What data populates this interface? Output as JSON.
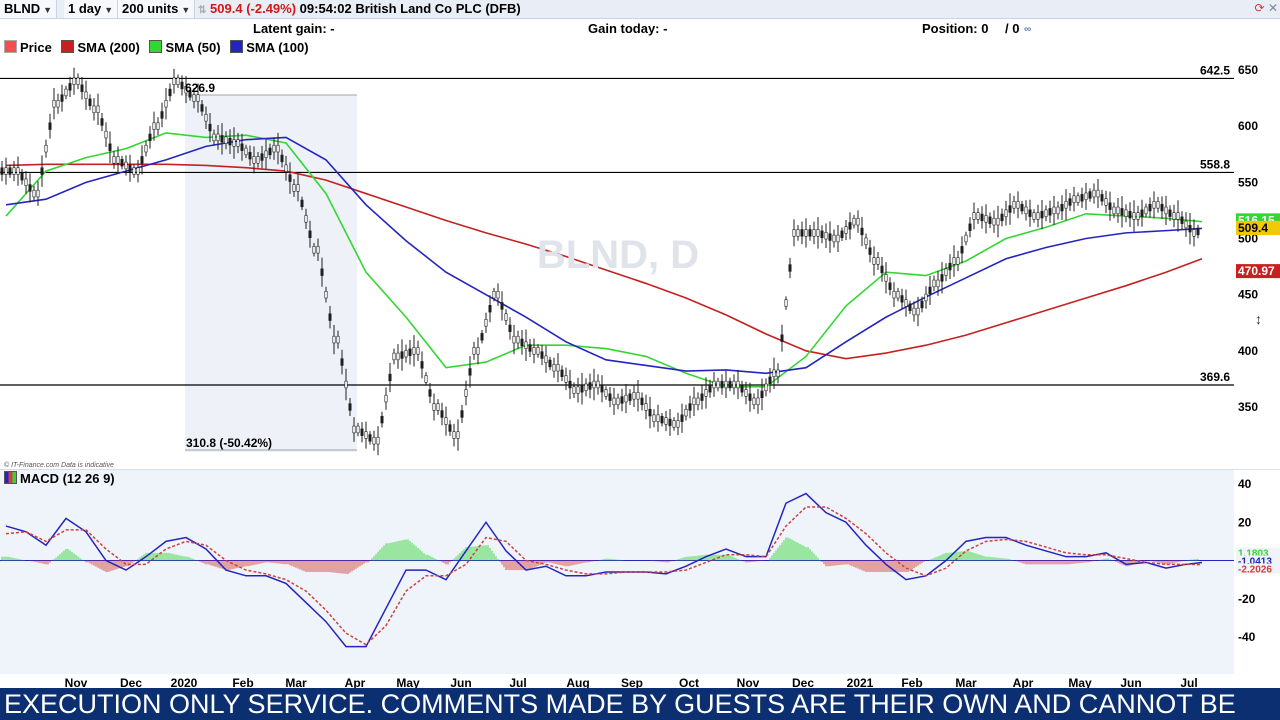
{
  "toolbar": {
    "symbol": "BLND",
    "interval": "1 day",
    "units": "200 units",
    "price": "509.4",
    "change": "(-2.49%)",
    "time": "09:54:02",
    "instrument": "British Land Co PLC (DFB)"
  },
  "info": {
    "latent_gain": "Latent gain: -",
    "gain_today": "Gain today: -",
    "position": "Position: 0",
    "position_sep": "/ 0"
  },
  "legend": [
    {
      "label": "Price",
      "color": "#e8f0e8"
    },
    {
      "label": "SMA (200)",
      "color": "#c62020"
    },
    {
      "label": "SMA (50)",
      "color": "#33d633"
    },
    {
      "label": "SMA (100)",
      "color": "#2424c0"
    }
  ],
  "watermark": "BLND, D",
  "disclaimer": "© IT-Finance.com  Data is indicative",
  "macd_label": "MACD (12 26 9)",
  "ticker_text": "EXECUTION ONLY SERVICE. COMMENTS MADE BY GUESTS ARE THEIR OWN AND CANNOT BE",
  "chart_data": [
    {
      "type": "candlestick",
      "symbol": "BLND",
      "ylim": [
        300,
        675
      ],
      "y_ticks": [
        350,
        400,
        450,
        500,
        550,
        600,
        650
      ],
      "x_ticks": [
        "Nov",
        "Dec",
        "2020",
        "Feb",
        "Mar",
        "Apr",
        "May",
        "Jun",
        "Jul",
        "Aug",
        "Sep",
        "Oct",
        "Nov",
        "Dec",
        "2021",
        "Feb",
        "Mar",
        "Apr",
        "May",
        "Jun",
        "Jul"
      ],
      "horizontal_lines": [
        {
          "value": 642.5,
          "label": "642.5"
        },
        {
          "value": 558.8,
          "label": "558.8"
        },
        {
          "value": 369.6,
          "label": "369.6"
        }
      ],
      "annotations": [
        {
          "label": "626.9",
          "value": 626.9
        },
        {
          "label": "310.8 (-50.42%)",
          "value": 310.8
        }
      ],
      "last_values": [
        {
          "label": "516.15",
          "series": "SMA (50)",
          "color": "#33d633",
          "value": 516.15
        },
        {
          "label": "509.4",
          "series": "Price",
          "color": "#f2c800",
          "value": 509.4
        },
        {
          "label": "470.97",
          "series": "SMA (200)",
          "color": "#c62020",
          "value": 470.97
        }
      ],
      "series": [
        {
          "name": "SMA (200)",
          "color": "#c62020",
          "x": [
            0,
            40,
            80,
            120,
            160,
            200,
            240,
            280,
            320,
            360,
            400,
            440,
            480,
            520,
            560,
            600,
            640,
            680,
            720,
            760,
            800,
            840,
            880,
            920,
            960,
            1000,
            1040,
            1080,
            1120,
            1160,
            1196
          ],
          "values": [
            565,
            566,
            566,
            566,
            566,
            565,
            563,
            560,
            552,
            540,
            528,
            516,
            505,
            495,
            484,
            472,
            460,
            447,
            432,
            415,
            400,
            393,
            398,
            405,
            414,
            425,
            436,
            447,
            458,
            470,
            482
          ]
        },
        {
          "name": "SMA (50)",
          "color": "#33d633",
          "x": [
            0,
            40,
            80,
            120,
            160,
            200,
            240,
            280,
            320,
            360,
            400,
            440,
            480,
            520,
            560,
            600,
            640,
            680,
            720,
            760,
            800,
            840,
            880,
            920,
            960,
            1000,
            1040,
            1080,
            1120,
            1160,
            1196
          ],
          "values": [
            520,
            560,
            572,
            580,
            594,
            590,
            592,
            585,
            540,
            470,
            430,
            385,
            390,
            405,
            405,
            402,
            395,
            380,
            368,
            368,
            395,
            440,
            470,
            467,
            480,
            500,
            510,
            522,
            520,
            518,
            515
          ]
        },
        {
          "name": "SMA (100)",
          "color": "#2424c0",
          "x": [
            0,
            40,
            80,
            120,
            160,
            200,
            240,
            280,
            320,
            360,
            400,
            440,
            480,
            520,
            560,
            600,
            640,
            680,
            720,
            760,
            800,
            840,
            880,
            920,
            960,
            1000,
            1040,
            1080,
            1120,
            1160,
            1196
          ],
          "values": [
            530,
            535,
            550,
            560,
            570,
            582,
            588,
            590,
            570,
            530,
            498,
            470,
            450,
            430,
            408,
            392,
            387,
            382,
            383,
            380,
            385,
            408,
            430,
            448,
            465,
            482,
            492,
            500,
            505,
            507,
            509
          ]
        },
        {
          "name": "Price",
          "color": "#1f1f1f",
          "x": [
            0,
            20,
            40,
            60,
            80,
            100,
            120,
            140,
            160,
            180,
            200,
            220,
            240,
            260,
            280,
            300,
            320,
            340,
            360,
            380,
            400,
            420,
            440,
            460,
            480,
            500,
            520,
            540,
            560,
            580,
            600,
            620,
            640,
            660,
            680,
            700,
            720,
            740,
            760,
            780,
            800,
            820,
            840,
            860,
            880,
            900,
            920,
            940,
            960,
            980,
            1000,
            1020,
            1040,
            1060,
            1080,
            1100,
            1120,
            1140,
            1160,
            1180,
            1196
          ],
          "values": [
            560,
            540,
            620,
            640,
            615,
            570,
            560,
            600,
            640,
            625,
            590,
            585,
            570,
            580,
            545,
            490,
            410,
            330,
            320,
            395,
            400,
            350,
            325,
            400,
            450,
            410,
            400,
            385,
            365,
            370,
            355,
            360,
            340,
            335,
            355,
            370,
            370,
            355,
            380,
            505,
            505,
            500,
            515,
            480,
            450,
            435,
            460,
            480,
            520,
            515,
            530,
            520,
            525,
            535,
            540,
            525,
            520,
            530,
            520,
            505,
            510
          ]
        }
      ]
    },
    {
      "type": "line",
      "title": "MACD (12 26 9)",
      "ylim": [
        -50,
        45
      ],
      "y_ticks": [
        -40,
        -20,
        20,
        40
      ],
      "last_values": [
        {
          "label": "1.1803",
          "color": "#33d633",
          "value": 1.1803
        },
        {
          "label": "-1.0413",
          "color": "#2424c0",
          "value": -1.0413
        },
        {
          "label": "-2.2026",
          "color": "#d04040",
          "value": -2.2026
        }
      ],
      "series": [
        {
          "name": "MACD",
          "color": "#2424c0",
          "x": [
            0,
            20,
            40,
            60,
            80,
            100,
            120,
            140,
            160,
            180,
            200,
            220,
            240,
            260,
            280,
            300,
            320,
            340,
            360,
            380,
            400,
            420,
            440,
            460,
            480,
            500,
            520,
            540,
            560,
            580,
            600,
            620,
            640,
            660,
            680,
            700,
            720,
            740,
            760,
            780,
            800,
            820,
            840,
            860,
            880,
            900,
            920,
            940,
            960,
            980,
            1000,
            1020,
            1040,
            1060,
            1080,
            1100,
            1120,
            1140,
            1160,
            1180,
            1196
          ],
          "values": [
            18,
            15,
            8,
            22,
            15,
            0,
            -5,
            2,
            10,
            12,
            6,
            -5,
            -8,
            -8,
            -12,
            -22,
            -32,
            -45,
            -45,
            -25,
            -5,
            -5,
            -10,
            5,
            20,
            5,
            -5,
            -3,
            -8,
            -8,
            -6,
            -6,
            -6,
            -7,
            -3,
            2,
            6,
            2,
            2,
            30,
            35,
            25,
            20,
            8,
            -2,
            -10,
            -8,
            0,
            10,
            12,
            12,
            8,
            5,
            2,
            2,
            4,
            -2,
            -1,
            -4,
            -2,
            -1.0413
          ]
        },
        {
          "name": "Signal",
          "color": "#d04040",
          "dashed": true,
          "x": [
            0,
            20,
            40,
            60,
            80,
            100,
            120,
            140,
            160,
            180,
            200,
            220,
            240,
            260,
            280,
            300,
            320,
            340,
            360,
            380,
            400,
            420,
            440,
            460,
            480,
            500,
            520,
            540,
            560,
            580,
            600,
            620,
            640,
            660,
            680,
            700,
            720,
            740,
            760,
            780,
            800,
            820,
            840,
            860,
            880,
            900,
            920,
            940,
            960,
            980,
            1000,
            1020,
            1040,
            1060,
            1080,
            1100,
            1120,
            1140,
            1160,
            1180,
            1196
          ],
          "values": [
            14,
            15,
            10,
            16,
            16,
            6,
            -2,
            -2,
            6,
            10,
            8,
            0,
            -5,
            -7,
            -10,
            -16,
            -26,
            -38,
            -44,
            -34,
            -16,
            -8,
            -8,
            -2,
            12,
            10,
            0,
            -2,
            -5,
            -7,
            -7,
            -6,
            -6,
            -6,
            -5,
            -1,
            3,
            3,
            2,
            18,
            28,
            28,
            22,
            14,
            4,
            -4,
            -8,
            -4,
            5,
            10,
            11,
            10,
            7,
            4,
            3,
            3,
            1,
            -1,
            -2,
            -2,
            -2.2026
          ]
        },
        {
          "name": "Histogram",
          "color": "#33d633",
          "negative_color": "#d04040",
          "x": [
            0,
            20,
            40,
            60,
            80,
            100,
            120,
            140,
            160,
            180,
            200,
            220,
            240,
            260,
            280,
            300,
            320,
            340,
            360,
            380,
            400,
            420,
            440,
            460,
            480,
            500,
            520,
            540,
            560,
            580,
            600,
            620,
            640,
            660,
            680,
            700,
            720,
            740,
            760,
            780,
            800,
            820,
            840,
            860,
            880,
            900,
            920,
            940,
            960,
            980,
            1000,
            1020,
            1040,
            1060,
            1080,
            1100,
            1120,
            1140,
            1160,
            1180,
            1196
          ],
          "values": [
            2,
            0,
            -2,
            6,
            -1,
            -6,
            -3,
            4,
            4,
            2,
            -2,
            -5,
            -3,
            -1,
            -2,
            -6,
            -6,
            -7,
            -1,
            9,
            11,
            3,
            -2,
            7,
            8,
            -5,
            -5,
            -1,
            -3,
            -1,
            1,
            0,
            0,
            -1,
            2,
            3,
            3,
            -1,
            0,
            12,
            7,
            -3,
            -2,
            -6,
            -6,
            -6,
            0,
            4,
            5,
            2,
            1,
            -2,
            -2,
            -2,
            -1,
            1,
            -3,
            0,
            -2,
            0,
            1.18
          ]
        }
      ]
    }
  ]
}
